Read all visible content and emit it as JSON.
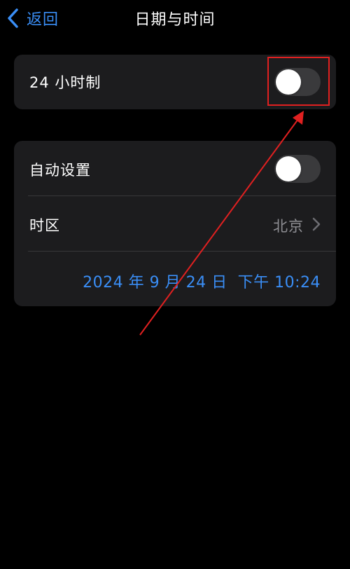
{
  "nav": {
    "back_label": "返回",
    "title": "日期与时间"
  },
  "settings": {
    "hour24": {
      "label": "24 小时制",
      "on": false
    },
    "auto_set": {
      "label": "自动设置",
      "on": false
    },
    "timezone": {
      "label": "时区",
      "value": "北京"
    },
    "datetime": "2024 年 9 月 24 日  下午 10:24"
  },
  "colors": {
    "background": "#000000",
    "group_background": "#1c1c1e",
    "accent": "#3a8ef6",
    "secondary_text": "#8e8e93",
    "toggle_off": "#3a3a3c",
    "annotation": "#e02020"
  },
  "icons": {
    "back": "chevron-left-icon",
    "disclosure": "chevron-right-icon"
  }
}
